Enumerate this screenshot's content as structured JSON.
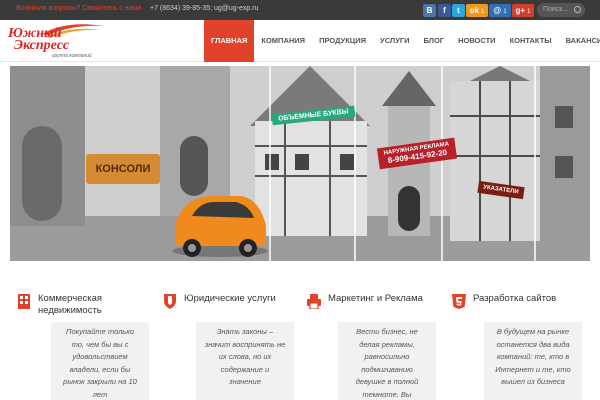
{
  "topbar": {
    "question": "Возникли вопросы? Свяжитесь с нами",
    "contacts": "+7 (8634) 39-85-35; ug@ug-exp.ru",
    "social": [
      {
        "icon": "vk-icon",
        "label": "В",
        "count": ""
      },
      {
        "icon": "facebook-icon",
        "label": "f",
        "count": ""
      },
      {
        "icon": "twitter-icon",
        "label": "t",
        "count": ""
      },
      {
        "icon": "odnoklassniki-icon",
        "label": "ok",
        "count": "1"
      },
      {
        "icon": "mailru-icon",
        "label": "@",
        "count": "1"
      },
      {
        "icon": "google-plus-icon",
        "label": "g+",
        "count": "1"
      }
    ],
    "search_placeholder": "Поиск..."
  },
  "logo": {
    "line1": "Южный",
    "line2": "Экспресс",
    "sub": "группа компаний"
  },
  "nav": {
    "items": [
      "ГЛАВНАЯ",
      "КОМПАНИЯ",
      "ПРОДУКЦИЯ",
      "УСЛУГИ",
      "БЛОГ",
      "НОВОСТИ",
      "КОНТАКТЫ",
      "ВАКАНСИИ"
    ],
    "active": "ГЛАВНАЯ"
  },
  "banner": {
    "sign_console": "КОНСОЛИ",
    "sign_volume": "ОБЪЕМНЫЕ БУКВЫ",
    "sign_outdoor": "НАРУЖНАЯ РЕКЛАМА",
    "sign_phone": "8-909-415-92-20",
    "sign_pointers": "УКАЗАТЕЛИ"
  },
  "features": [
    {
      "icon": "building-icon",
      "title": "Коммерческая недвижимость",
      "text": "Покупайте только то, чем бы вы с удовольствием владели, если бы рынок закрыли на 10 лет"
    },
    {
      "icon": "shield-icon",
      "title": "Юридические услуги",
      "text": "Знать законы – значит воспринять не их слова, но их содержание и значение"
    },
    {
      "icon": "printer-icon",
      "title": "Маркетинг и Реклама",
      "text": "Вести бизнес, не делая рекламы, равносильно подмигиванию девушке в полной темноте. Вы"
    },
    {
      "icon": "html5-icon",
      "title": "Разработка сайтов",
      "text": "В будущем на рынке останется два вида компаний: те, кто в Интернет и те, кто вышел из бизнеса"
    }
  ],
  "colors": {
    "accent": "#e0422a",
    "topbar": "#3a3a3a",
    "card": "#f1f1f1"
  }
}
